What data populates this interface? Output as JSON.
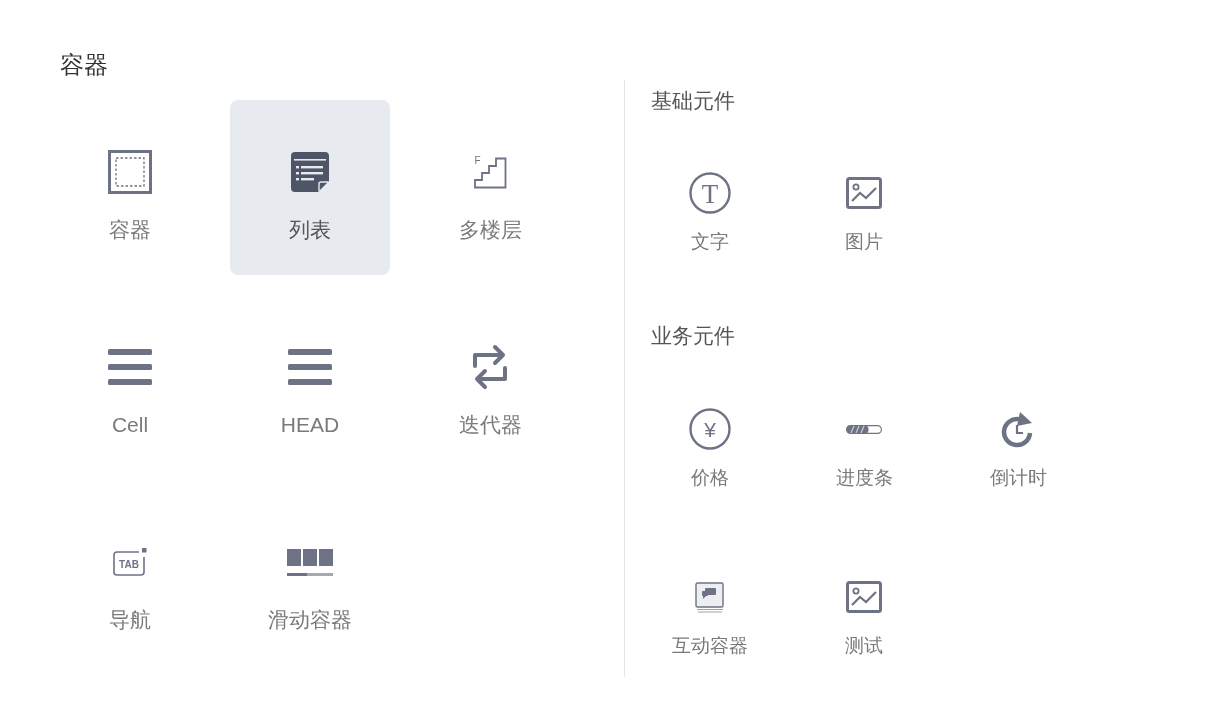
{
  "containers": {
    "title": "容器",
    "items": [
      {
        "label": "容器",
        "selected": false
      },
      {
        "label": "列表",
        "selected": true
      },
      {
        "label": "多楼层",
        "selected": false,
        "icon_text": "F"
      },
      {
        "label": "Cell",
        "selected": false
      },
      {
        "label": "HEAD",
        "selected": false
      },
      {
        "label": "迭代器",
        "selected": false
      },
      {
        "label": "导航",
        "selected": false,
        "icon_text": "TAB"
      },
      {
        "label": "滑动容器",
        "selected": false
      }
    ]
  },
  "basic_components": {
    "title": "基础元件",
    "items": [
      {
        "label": "文字",
        "selected": false,
        "icon_text": "T"
      },
      {
        "label": "图片",
        "selected": false
      }
    ]
  },
  "business_components": {
    "title": "业务元件",
    "items": [
      {
        "label": "价格",
        "selected": false,
        "icon_text": "¥"
      },
      {
        "label": "进度条",
        "selected": false
      },
      {
        "label": "倒计时",
        "selected": false
      },
      {
        "label": "互动容器",
        "selected": false
      },
      {
        "label": "测试",
        "selected": false
      }
    ]
  }
}
